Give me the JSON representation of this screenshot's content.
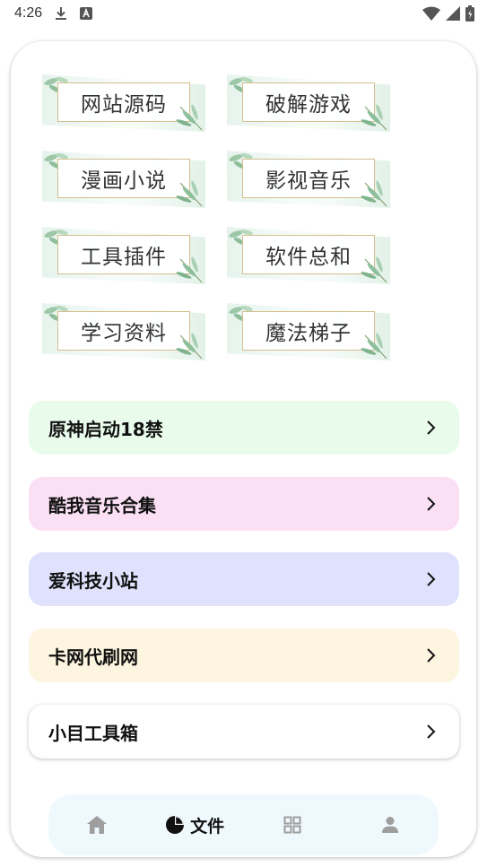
{
  "status_bar": {
    "time": "4:26",
    "icons": [
      "download-icon",
      "app-notification-icon",
      "wifi-icon",
      "signal-icon",
      "battery-icon"
    ]
  },
  "category_tiles": [
    {
      "label": "网站源码"
    },
    {
      "label": "破解游戏"
    },
    {
      "label": "漫画小说"
    },
    {
      "label": "影视音乐"
    },
    {
      "label": "工具插件"
    },
    {
      "label": "软件总和"
    },
    {
      "label": "学习资料"
    },
    {
      "label": "魔法梯子"
    }
  ],
  "link_list": [
    {
      "label": "原神启动18禁",
      "bg": "#e9fcec"
    },
    {
      "label": "酷我音乐合集",
      "bg": "#fbe0f5"
    },
    {
      "label": "爱科技小站",
      "bg": "#e0e2fd"
    },
    {
      "label": "卡网代刷网",
      "bg": "#fdf5df"
    },
    {
      "label": "小目工具箱",
      "bg": "#ffffff"
    }
  ],
  "bottom_nav": {
    "items": [
      {
        "icon": "home-icon",
        "label": ""
      },
      {
        "icon": "pie-chart-icon",
        "label": "文件",
        "active": true
      },
      {
        "icon": "grid-icon",
        "label": ""
      },
      {
        "icon": "user-icon",
        "label": ""
      }
    ]
  },
  "colors": {
    "icon_inactive": "#9e9e9e",
    "icon_active": "#111111",
    "nav_bg": "#eff8fc",
    "tile_frame": "#d6bf8f"
  }
}
